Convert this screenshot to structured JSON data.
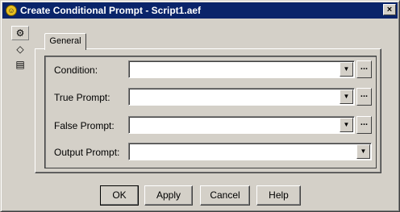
{
  "window": {
    "title": "Create Conditional Prompt - Script1.aef",
    "close_glyph": "×"
  },
  "sidebar": {
    "icons": [
      {
        "name": "properties-icon",
        "glyph": "⚙"
      },
      {
        "name": "tag-icon",
        "glyph": "◇"
      },
      {
        "name": "notes-icon",
        "glyph": "▤"
      }
    ]
  },
  "tabs": [
    {
      "label": "General"
    }
  ],
  "form": {
    "condition_label": "Condition:",
    "condition_value": "",
    "true_prompt_label": "True Prompt:",
    "true_prompt_value": "",
    "false_prompt_label": "False Prompt:",
    "false_prompt_value": "",
    "output_prompt_label": "Output Prompt:",
    "output_prompt_value": "",
    "arrow_glyph": "▼",
    "browse_label": "..."
  },
  "buttons": {
    "ok": "OK",
    "apply": "Apply",
    "cancel": "Cancel",
    "help": "Help"
  }
}
